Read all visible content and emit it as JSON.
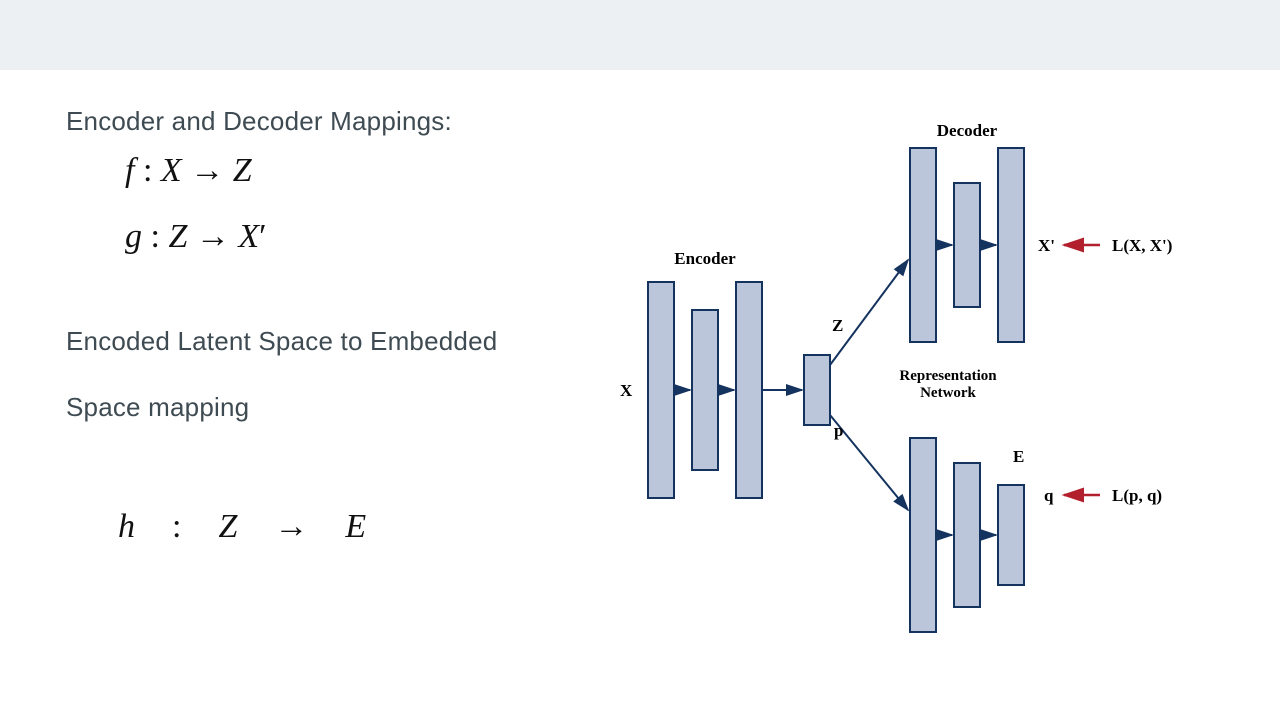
{
  "text": {
    "heading1": "Encoder and Decoder Mappings:",
    "heading2a": "Encoded Latent Space to Embedded",
    "heading2b": "Space mapping"
  },
  "math": {
    "f": "f : X → Z",
    "g": "g : Z → X′",
    "h": "h  :  Z  →  E"
  },
  "diagram": {
    "labels": {
      "encoder": "Encoder",
      "decoder": "Decoder",
      "X": "X",
      "Z": "Z",
      "p": "p",
      "Xprime": "X'",
      "repnet1": "Representation",
      "repnet2": "Network",
      "E": "E",
      "q": "q",
      "loss1": "L(X, X')",
      "loss2": "L(p, q)"
    },
    "colors": {
      "fill": "#bcc6da",
      "stroke": "#14335f",
      "arrowBlue": "#14335f",
      "arrowRed": "#b21f2d"
    }
  }
}
